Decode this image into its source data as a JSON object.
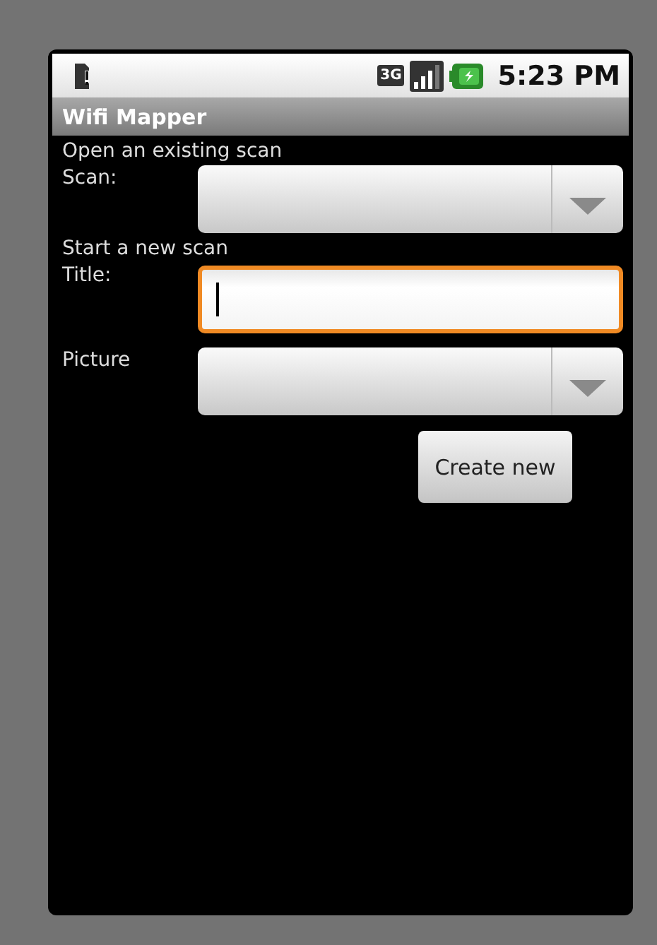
{
  "status_bar": {
    "time": "5:23 PM",
    "network": "3G"
  },
  "title_bar": {
    "title": "Wifi Mapper"
  },
  "open_section": {
    "heading": "Open an existing scan",
    "scan_label": "Scan:"
  },
  "new_section": {
    "heading": "Start a new scan",
    "title_label": "Title:",
    "title_field": {
      "focused": true
    },
    "picture_label": "Picture"
  },
  "buttons": [
    "Create new"
  ]
}
